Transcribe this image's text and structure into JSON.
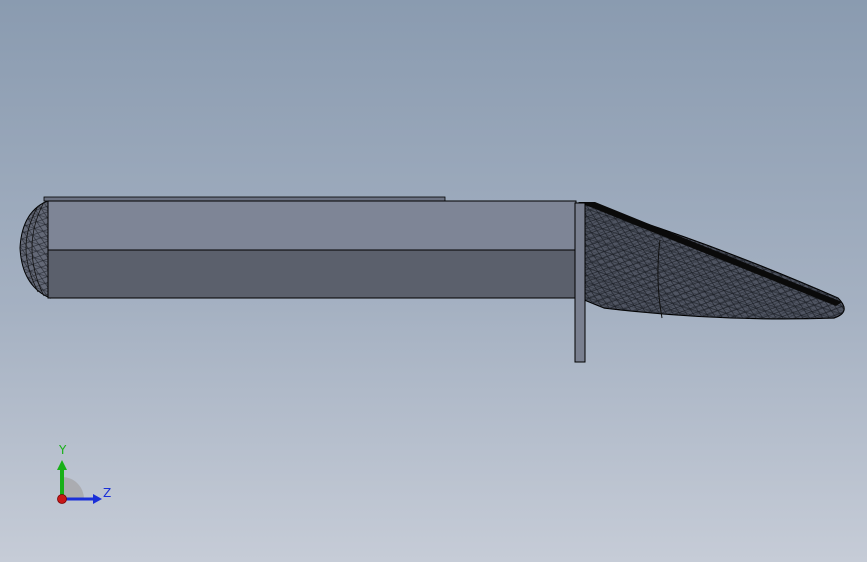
{
  "viewport": {
    "background_top": "#8a9bb0",
    "background_bottom": "#c6ccd7"
  },
  "model": {
    "body_top_color": "#7e8596",
    "body_bottom_color": "#5b606c",
    "edge_color": "#000000"
  },
  "triad": {
    "y_label": "Y",
    "z_label": "Z",
    "y_color": "#18b018",
    "z_color": "#1a2fd8",
    "x_color": "#c81818"
  }
}
